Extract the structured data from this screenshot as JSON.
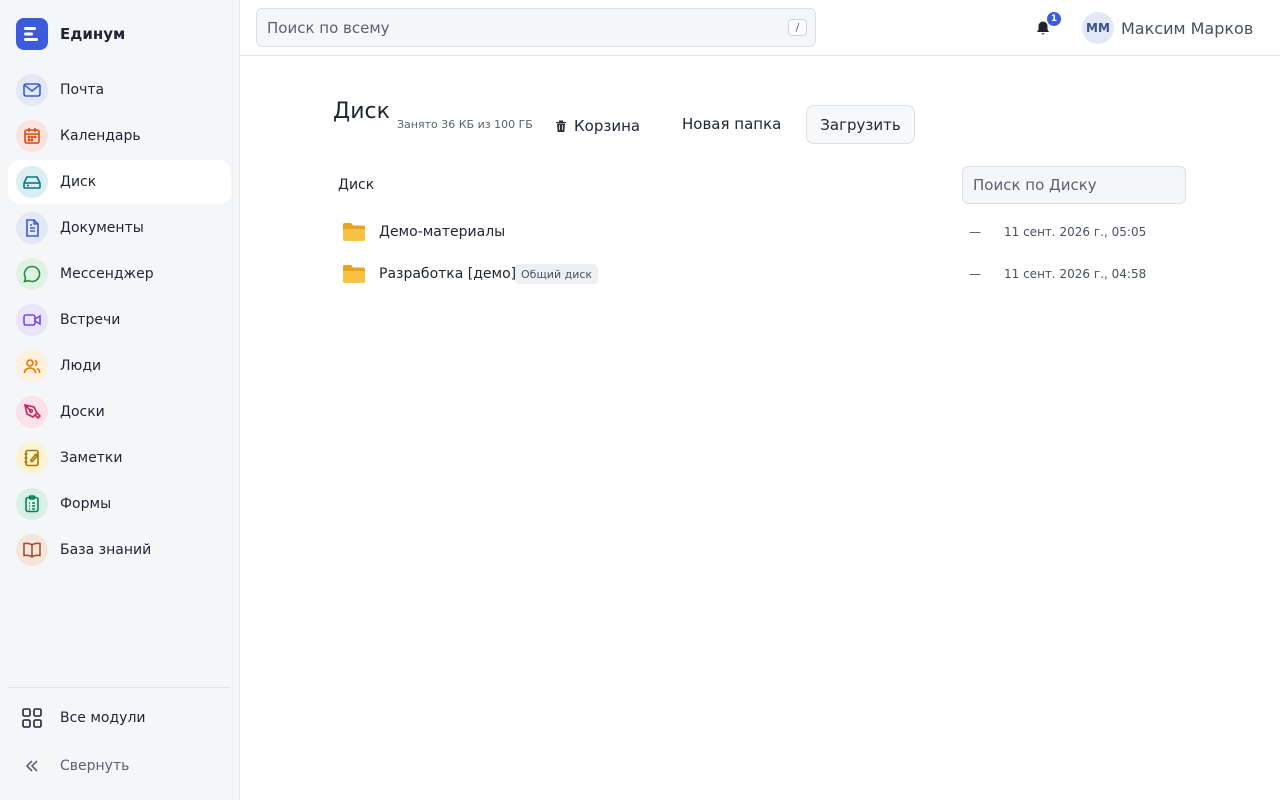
{
  "app": {
    "name": "Единум"
  },
  "sidebar": {
    "items": [
      {
        "label": "Почта",
        "icon": "mail-icon",
        "color": "#3b5bdb",
        "bg": "#e3e8f7"
      },
      {
        "label": "Календарь",
        "icon": "calendar-icon",
        "color": "#d9480f",
        "bg": "#fbe4dd"
      },
      {
        "label": "Диск",
        "icon": "drive-icon",
        "color": "#0b7285",
        "bg": "#dbeff2",
        "active": true
      },
      {
        "label": "Документы",
        "icon": "document-icon",
        "color": "#3b5bdb",
        "bg": "#e3e8f7"
      },
      {
        "label": "Мессенджер",
        "icon": "chat-icon",
        "color": "#2b8a3e",
        "bg": "#dff2e3"
      },
      {
        "label": "Встречи",
        "icon": "video-icon",
        "color": "#7048e8",
        "bg": "#ebe5fb"
      },
      {
        "label": "Люди",
        "icon": "people-icon",
        "color": "#e67700",
        "bg": "#fdf0dc"
      },
      {
        "label": "Доски",
        "icon": "pen-icon",
        "color": "#c2255c",
        "bg": "#fae1ea"
      },
      {
        "label": "Заметки",
        "icon": "notes-icon",
        "color": "#a87b00",
        "bg": "#fcf3d0"
      },
      {
        "label": "Формы",
        "icon": "form-icon",
        "color": "#087f5b",
        "bg": "#d9f0e8"
      },
      {
        "label": "База знаний",
        "icon": "book-icon",
        "color": "#a0522d",
        "bg": "#f5e6dc"
      }
    ],
    "all_modules": "Все модули",
    "collapse": "Свернуть"
  },
  "topbar": {
    "search_placeholder": "Поиск по всему",
    "search_shortcut": "/",
    "notification_count": "1",
    "user_initials": "ММ",
    "user_name": "Максим Марков"
  },
  "main": {
    "title": "Диск",
    "usage": "Занято 36 КБ из 100 ГБ",
    "trash_label": "Корзина",
    "new_folder_label": "Новая папка",
    "upload_label": "Загрузить",
    "breadcrumb": "Диск",
    "search_placeholder": "Поиск по Диску",
    "files": [
      {
        "name": "Демо-материалы",
        "tag": "",
        "size": "—",
        "date": "11 сент. 2026 г., 05:05"
      },
      {
        "name": "Разработка [демо]",
        "tag": "Общий диск",
        "size": "—",
        "date": "11 сент. 2026 г., 04:58"
      }
    ]
  },
  "colors": {
    "accent": "#3b5bdb",
    "folder": "#f2b233"
  }
}
